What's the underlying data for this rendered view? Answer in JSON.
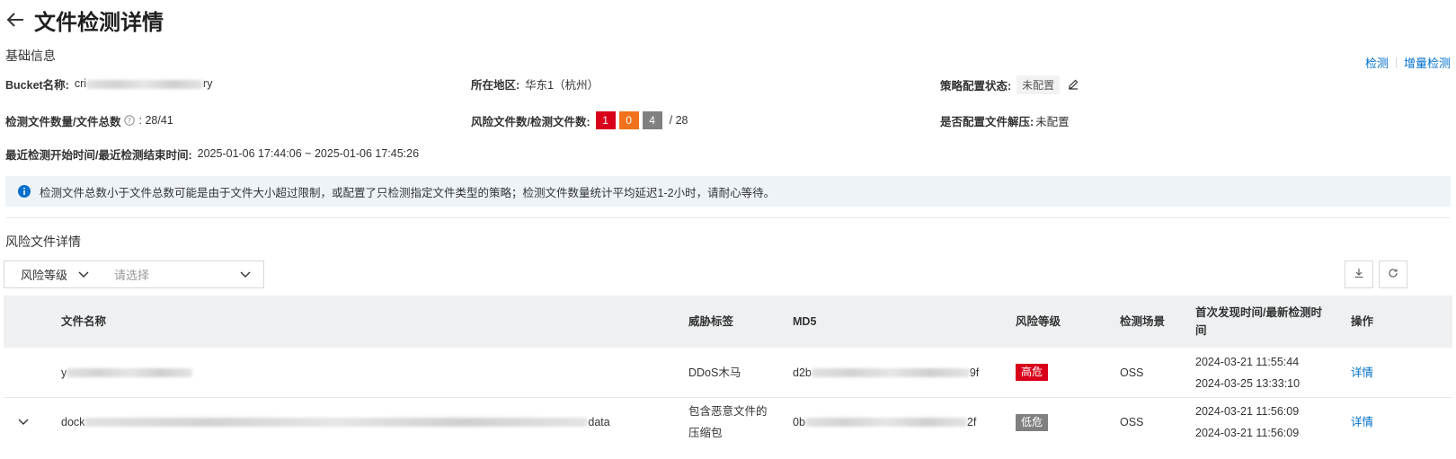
{
  "header": {
    "title": "文件检测详情"
  },
  "basic": {
    "section_title": "基础信息",
    "links": {
      "detect": "检测",
      "incremental": "增量检测"
    },
    "bucket_label": "Bucket名称:",
    "bucket_value_prefix": "cri",
    "bucket_value_suffix": "ry",
    "region_label": "所在地区:",
    "region_value": "华东1（杭州）",
    "policy_label": "策略配置状态:",
    "policy_value": "未配置",
    "count_label": "检测文件数量/文件总数",
    "count_value": "28/41",
    "risk_count_label": "风险文件数/检测文件数:",
    "risk_high": "1",
    "risk_mid": "0",
    "risk_low": "4",
    "risk_total": "/ 28",
    "decompress_label": "是否配置文件解压:",
    "decompress_value": "未配置",
    "time_label": "最近检测开始时间/最近检测结束时间:",
    "time_value": "2025-01-06 17:44:06 ~ 2025-01-06 17:45:26"
  },
  "banner": {
    "text": "检测文件总数小于文件总数可能是由于文件大小超过限制，或配置了只检测指定文件类型的策略；检测文件数量统计平均延迟1-2小时，请耐心等待。"
  },
  "risk_section": {
    "title": "风险文件详情",
    "filter_type": "风险等级",
    "filter_placeholder": "请选择"
  },
  "table": {
    "columns": {
      "name": "文件名称",
      "threat": "威胁标签",
      "md5": "MD5",
      "level": "风险等级",
      "scene": "检测场景",
      "time": "首次发现时间/最新检测时间",
      "action": "操作"
    },
    "rows": [
      {
        "name_prefix": "y",
        "name_suffix": "",
        "threat": "DDoS木马",
        "md5_prefix": "d2b",
        "md5_suffix": "9f",
        "level": "高危",
        "scene": "OSS",
        "first_time": "2024-03-21 11:55:44",
        "latest_time": "2024-03-25 13:33:10",
        "action": "详情"
      },
      {
        "name_prefix": "dock",
        "name_suffix": "data",
        "threat_line1": "包含恶意文件的",
        "threat_line2": "压缩包",
        "md5_prefix": "0b",
        "md5_suffix": "2f",
        "level": "低危",
        "scene": "OSS",
        "first_time": "2024-03-21 11:56:09",
        "latest_time": "2024-03-21 11:56:09",
        "action": "详情"
      }
    ]
  }
}
